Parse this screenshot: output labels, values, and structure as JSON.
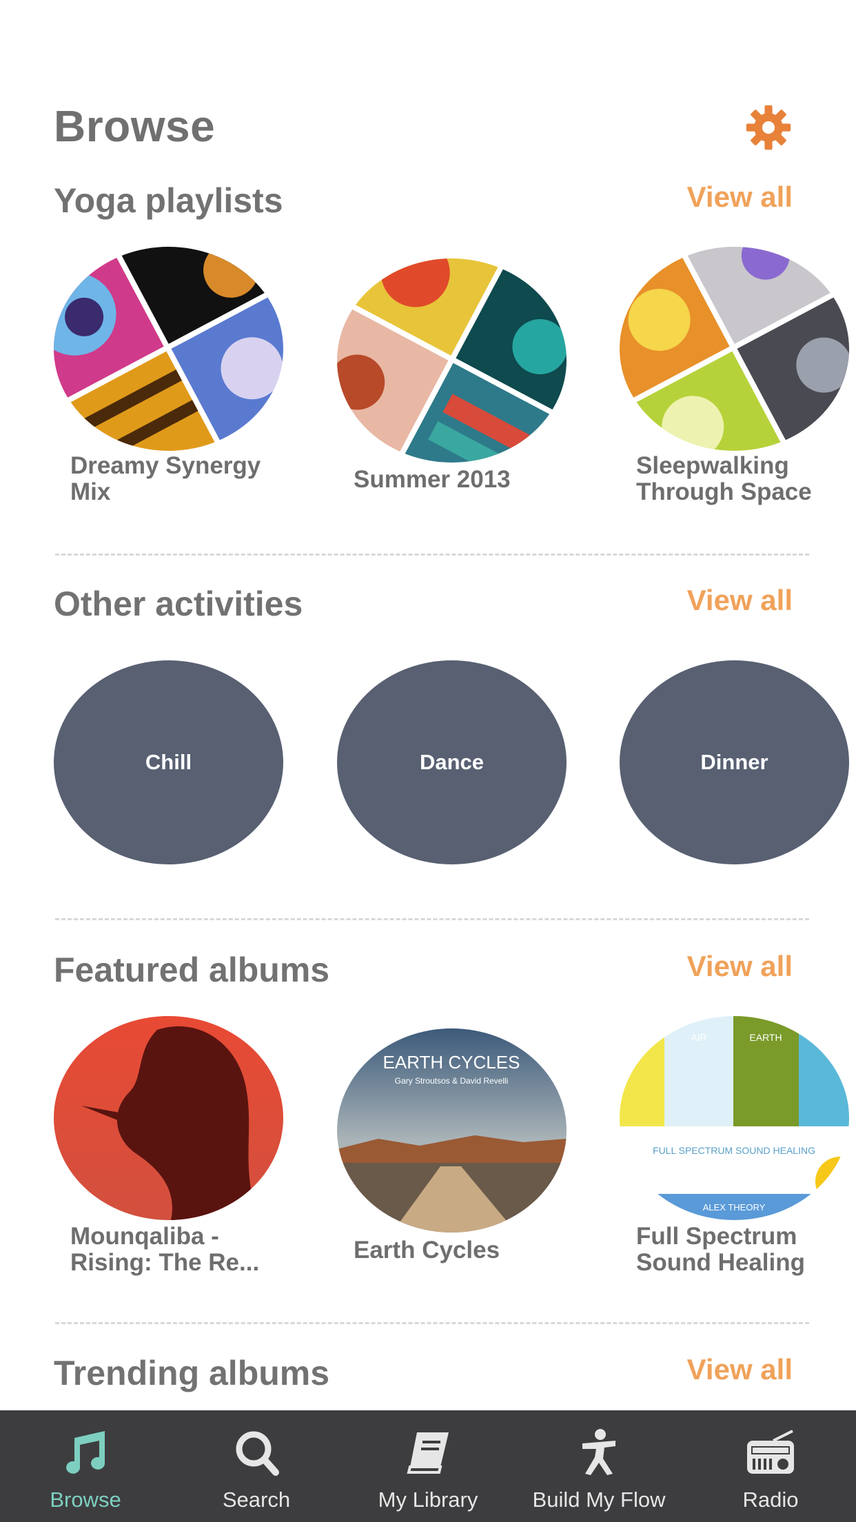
{
  "header": {
    "title": "Browse",
    "settings_icon": "gear-icon",
    "accent": "#e8823a"
  },
  "sections": {
    "yoga": {
      "title": "Yoga playlists",
      "view_all": "View all",
      "items": [
        {
          "title": "Dreamy Synergy Mix"
        },
        {
          "title": "Summer 2013"
        },
        {
          "title": "Sleepwalking Through Space"
        }
      ]
    },
    "activities": {
      "title": "Other activities",
      "view_all": "View all",
      "items": [
        {
          "label": "Chill"
        },
        {
          "label": "Dance"
        },
        {
          "label": "Dinner"
        }
      ]
    },
    "featured": {
      "title": "Featured albums",
      "view_all": "View all",
      "items": [
        {
          "title": "Mounqaliba - Rising: The Re..."
        },
        {
          "title": "Earth Cycles",
          "cover_title": "EARTH CYCLES",
          "cover_artist": "Gary Stroutsos & David Revelli"
        },
        {
          "title": "Full Spectrum Sound Healing",
          "cover_air": "AIR",
          "cover_earth": "EARTH",
          "cover_text": "FULL SPECTRUM SOUND HEALING",
          "cover_artist": "ALEX THEORY"
        }
      ]
    },
    "trending": {
      "title": "Trending albums",
      "view_all": "View all"
    }
  },
  "tabbar": {
    "items": [
      {
        "label": "Browse",
        "icon": "music-note-icon",
        "active": true
      },
      {
        "label": "Search",
        "icon": "search-icon",
        "active": false
      },
      {
        "label": "My Library",
        "icon": "book-icon",
        "active": false
      },
      {
        "label": "Build My Flow",
        "icon": "yoga-pose-icon",
        "active": false
      },
      {
        "label": "Radio",
        "icon": "radio-icon",
        "active": false
      }
    ]
  },
  "colors": {
    "view_all": "#f0a25a",
    "activity_bg": "#586072",
    "tabbar_bg": "#3d3d3f",
    "tab_active": "#7ecfc0"
  }
}
